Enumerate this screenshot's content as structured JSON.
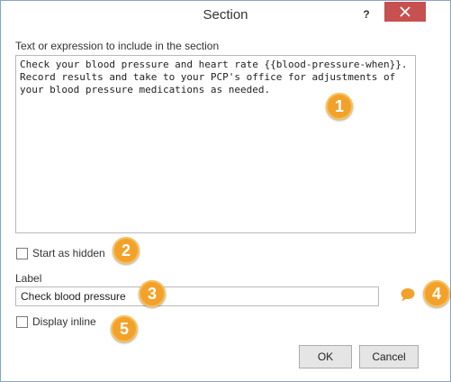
{
  "window": {
    "title": "Section",
    "help_label": "?"
  },
  "section_text": {
    "label": "Text or expression to include in the section",
    "value": "Check your blood pressure and heart rate {{blood-pressure-when}}.\nRecord results and take to your PCP's office for adjustments of\nyour blood pressure medications as needed."
  },
  "start_hidden": {
    "label": "Start as hidden",
    "checked": false
  },
  "label_field": {
    "label": "Label",
    "value": "Check blood pressure"
  },
  "display_inline": {
    "label": "Display inline",
    "checked": false
  },
  "buttons": {
    "ok": "OK",
    "cancel": "Cancel"
  },
  "callouts": [
    "1",
    "2",
    "3",
    "4",
    "5"
  ],
  "colors": {
    "close_button": "#c75050",
    "callout_fill": "#f2a22a",
    "comment_icon": "#f2a22a"
  },
  "icons": {
    "close": "close-icon",
    "comment": "speech-bubble-icon"
  }
}
